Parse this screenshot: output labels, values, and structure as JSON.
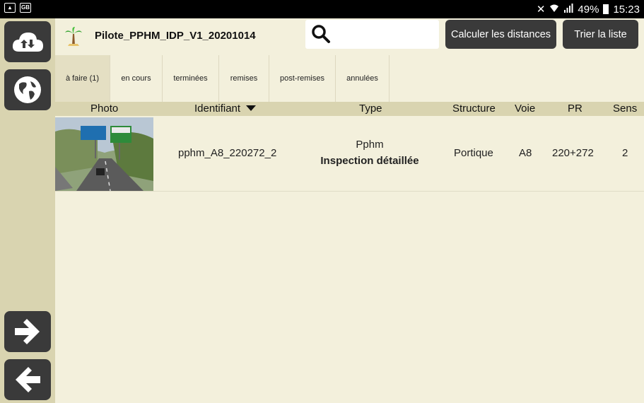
{
  "status_bar": {
    "time": "15:23",
    "battery": "49%"
  },
  "header": {
    "project_title": "Pilote_PPHM_IDP_V1_20201014",
    "search_value": "",
    "calc_button": "Calculer les distances",
    "sort_button": "Trier la liste"
  },
  "sidebar": {
    "sync_icon": "cloud-sync-icon",
    "map_icon": "globe-icon",
    "next_icon": "arrow-right-icon",
    "back_icon": "arrow-left-icon"
  },
  "tabs": [
    {
      "label": "à faire (1)"
    },
    {
      "label": "en cours"
    },
    {
      "label": "terminées"
    },
    {
      "label": "remises"
    },
    {
      "label": "post-remises"
    },
    {
      "label": "annulées"
    }
  ],
  "columns": {
    "photo": "Photo",
    "identifiant": "Identifiant",
    "type": "Type",
    "structure": "Structure",
    "voie": "Voie",
    "pr": "PR",
    "sens": "Sens"
  },
  "rows": [
    {
      "identifiant": "pphm_A8_220272_2",
      "type": "Pphm",
      "subtype": "Inspection détaillée",
      "structure": "Portique",
      "voie": "A8",
      "pr": "220+272",
      "sens": "2"
    }
  ]
}
